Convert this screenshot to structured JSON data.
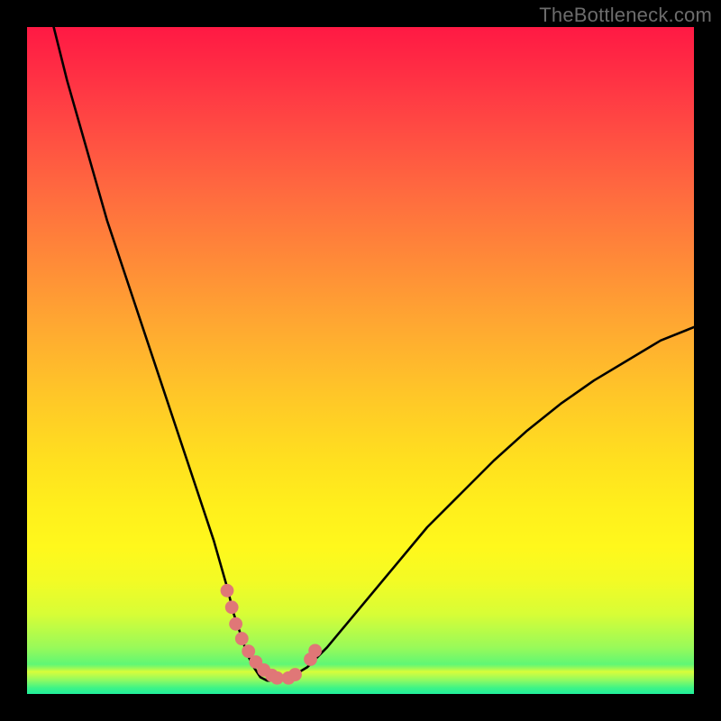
{
  "watermark": "TheBottleneck.com",
  "colors": {
    "frame": "#000000",
    "curve_stroke": "#000000",
    "marker_fill": "#e07777",
    "gradient_top": "#ff1944",
    "gradient_bottom": "#22ef9a"
  },
  "chart_data": {
    "type": "line",
    "title": "",
    "xlabel": "",
    "ylabel": "",
    "xlim": [
      0,
      100
    ],
    "ylim": [
      0,
      100
    ],
    "series": [
      {
        "name": "bottleneck-curve",
        "x": [
          4,
          6,
          8,
          10,
          12,
          14,
          16,
          18,
          20,
          22,
          24,
          26,
          28,
          30,
          31,
          32,
          33,
          34,
          35,
          36,
          37,
          38,
          40,
          42,
          45,
          50,
          55,
          60,
          65,
          70,
          75,
          80,
          85,
          90,
          95,
          100
        ],
        "y": [
          100,
          92,
          85,
          78,
          71,
          65,
          59,
          53,
          47,
          41,
          35,
          29,
          23,
          16,
          12,
          9,
          6,
          4,
          2.5,
          2,
          2,
          2.2,
          2.8,
          4,
          7,
          13,
          19,
          25,
          30,
          35,
          39.5,
          43.5,
          47,
          50,
          53,
          55
        ]
      }
    ],
    "markers": {
      "name": "highlighted-points",
      "x": [
        30,
        30.7,
        31.3,
        32.2,
        33.2,
        34.3,
        35.5,
        36.7,
        37.5,
        39.2,
        40.2,
        42.5,
        43.2
      ],
      "y": [
        15.5,
        13,
        10.5,
        8.3,
        6.4,
        4.8,
        3.6,
        2.8,
        2.4,
        2.4,
        2.9,
        5.2,
        6.5
      ]
    }
  }
}
